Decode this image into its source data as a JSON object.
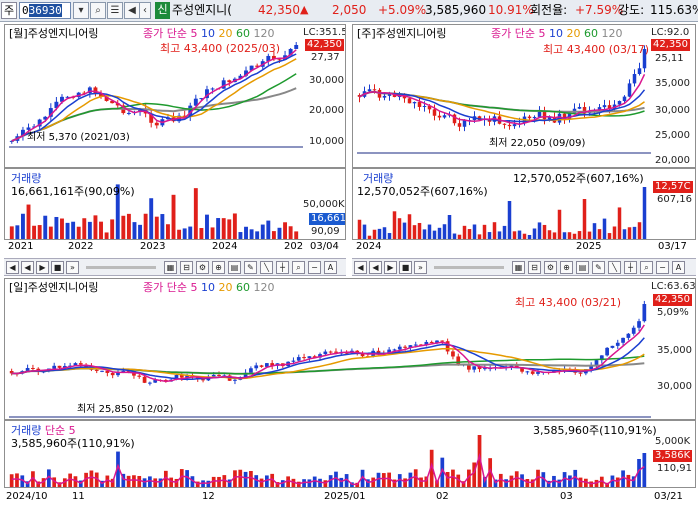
{
  "header": {
    "market_tab": "주",
    "code_prefix": "0",
    "code_selected": "36930",
    "stock_name": "주성엔지니(",
    "badge": "신",
    "price": "42,350",
    "change_arrow": "▲",
    "change": "2,050",
    "change_pct": "+5.09%",
    "volume": "3,585,960",
    "volume_pct": "10.91%",
    "turnover_label": "회전율:",
    "turnover": "+7.59%",
    "strength_label": "강도:",
    "strength": "115.63%"
  },
  "ma": {
    "label": "종가 단순",
    "p5": "5",
    "p10": "10",
    "p20": "20",
    "p60": "60",
    "p120": "120"
  },
  "monthly": {
    "title": "[월]주성엔지니어링",
    "lc": "LC:351.5",
    "high": "최고 43,400 (2025/03)",
    "low": "최저 5,370 (2021/03)",
    "y1": "30,000",
    "y2": "20,000",
    "y3": "10,000",
    "price_box": "42,350",
    "price_box2": "27,37",
    "vol_title": "거래량",
    "vol_value": "16,661,161주(90,09%)",
    "vol_y1": "50,000K",
    "vol_box": "16,661",
    "vol_box2": "90,09",
    "dates": [
      "2021",
      "2022",
      "2023",
      "2024",
      "202"
    ],
    "date_end": "03/04"
  },
  "weekly": {
    "title": "[주]주성엔지니어링",
    "lc": "LC:92.0",
    "high": "최고 43,400 (03/17)",
    "low": "최저 22,050 (09/09)",
    "y0": "25,11",
    "y1": "35,000",
    "y2": "30,000",
    "y3": "25,000",
    "y4": "20,000",
    "price_box": "42,350",
    "vol_title": "거래량",
    "vol_value": "12,570,052주(607,16%)",
    "vol_value_right": "12,570,052주(607,16%)",
    "vol_box": "12,57C",
    "vol_box2": "607,16",
    "dates": [
      "2024",
      "2025"
    ],
    "date_end": "03/17"
  },
  "daily": {
    "title": "[일]주성엔지니어링",
    "lc": "LC:63.63",
    "high": "최고 43,400 (03/21)",
    "low": "최저 25,850 (12/02)",
    "y1": "35,000",
    "y2": "30,000",
    "price_box": "42,350",
    "pct_box": "5,09%",
    "vol_title": "거래량",
    "vol_sub": "단순 5",
    "vol_value": "3,585,960주(110,91%)",
    "vol_value_right": "3,585,960주(110,91%)",
    "vol_y1": "5,000K",
    "vol_box": "3,586K",
    "vol_box2": "110,91",
    "dates": [
      "2024/10",
      "11",
      "12",
      "2025/01",
      "02",
      "03"
    ],
    "date_end": "03/21"
  },
  "colors": {
    "up": "#e0201a",
    "down": "#1a3fd0",
    "ma5": "#d9168f",
    "ma10": "#1a3fd0",
    "ma20": "#e69a00",
    "ma60": "#1e9a2e",
    "ma120": "#888888"
  }
}
